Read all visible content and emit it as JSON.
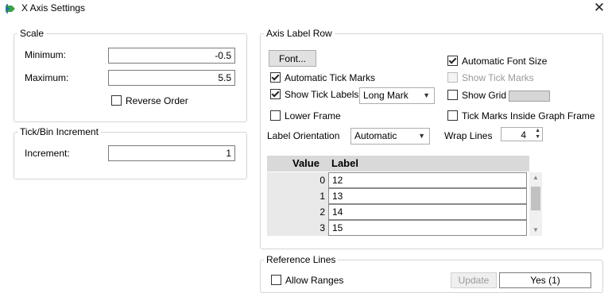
{
  "window": {
    "title": "X Axis Settings",
    "close_glyph": "✕",
    "icon": "graph-axis-icon"
  },
  "scale": {
    "legend": "Scale",
    "minimum_label": "Minimum:",
    "minimum_value": "-0.5",
    "maximum_label": "Maximum:",
    "maximum_value": "5.5",
    "reverse_label": "Reverse Order",
    "reverse_checked": false
  },
  "tick": {
    "legend": "Tick/Bin Increment",
    "increment_label": "Increment:",
    "increment_value": "1"
  },
  "axis_label_row": {
    "legend": "Axis Label Row",
    "font_button": "Font...",
    "auto_font_size": "Automatic Font Size",
    "auto_tick_marks": "Automatic Tick Marks",
    "show_tick_marks": "Show Tick Marks",
    "show_tick_labels": "Show Tick Labels",
    "tick_label_style": "Long Mark",
    "show_grid": "Show Grid",
    "grid_color": "#d6d6d6",
    "lower_frame": "Lower Frame",
    "tick_inside_frame": "Tick Marks Inside Graph Frame",
    "label_orientation_label": "Label Orientation",
    "label_orientation_value": "Automatic",
    "wrap_lines_label": "Wrap Lines",
    "wrap_lines_value": "4",
    "table": {
      "headers": [
        "Value",
        "Label"
      ],
      "rows": [
        {
          "value": "0",
          "label": "12"
        },
        {
          "value": "1",
          "label": "13"
        },
        {
          "value": "2",
          "label": "14"
        },
        {
          "value": "3",
          "label": "15"
        }
      ]
    }
  },
  "reference_lines": {
    "legend": "Reference Lines",
    "allow_ranges": "Allow Ranges",
    "update_button": "Update",
    "yes_value": "Yes (1)"
  }
}
